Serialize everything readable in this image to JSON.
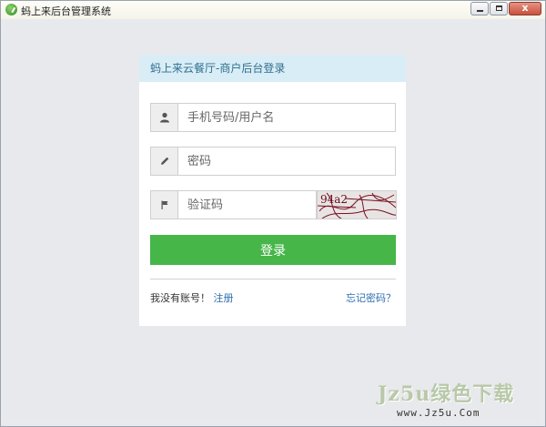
{
  "window": {
    "title": "蚂上来后台管理系统",
    "close_label": "x"
  },
  "login": {
    "header": "蚂上来云餐厅-商户后台登录",
    "username_placeholder": "手机号码/用户名",
    "password_placeholder": "密码",
    "captcha_placeholder": "验证码",
    "captcha_text": "94a2",
    "login_button": "登录",
    "no_account_text": "我没有账号！",
    "register_link": "注册",
    "forgot_link": "忘记密码？"
  },
  "watermark": {
    "brand": "Jz5u绿色下载",
    "url": "www.Jz5u.Com"
  },
  "colors": {
    "header_bg": "#d9edf6",
    "header_text": "#2f6f8f",
    "login_button": "#46b649",
    "link": "#2f6fb0"
  },
  "icons": {
    "username": "user-icon",
    "password": "pencil-icon",
    "captcha": "flag-icon"
  }
}
